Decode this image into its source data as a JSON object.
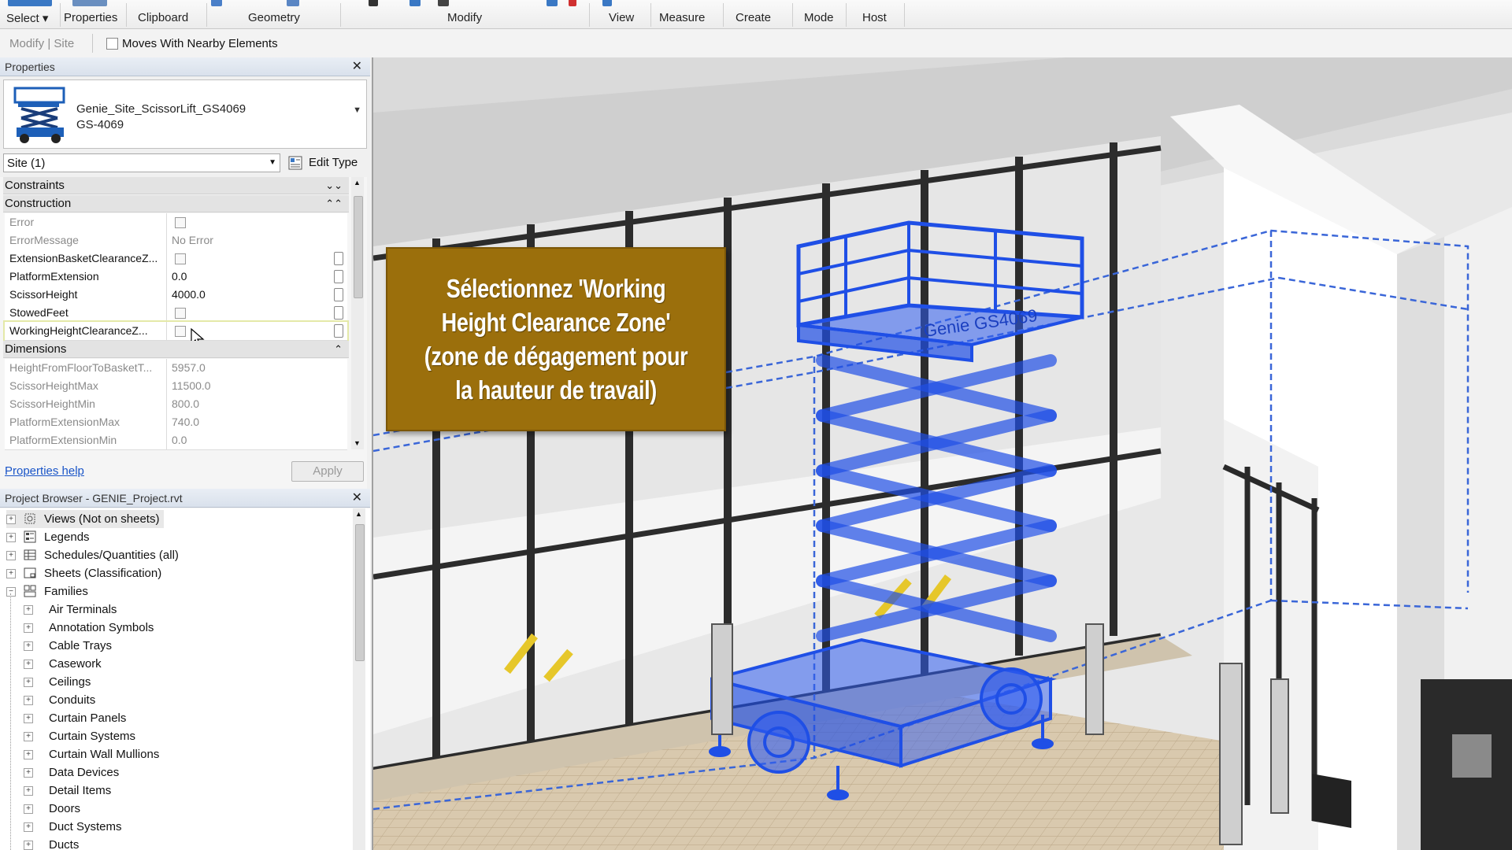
{
  "ribbon": {
    "tabs": [
      "Select",
      "Properties",
      "Clipboard",
      "Geometry",
      "Modify",
      "View",
      "Measure",
      "Create",
      "Mode",
      "Host"
    ],
    "select_caret": "▾"
  },
  "optionsbar": {
    "context": "Modify | Site",
    "moves_with_label": "Moves With Nearby Elements"
  },
  "properties": {
    "title": "Properties",
    "close": "✕",
    "family_name": "Genie_Site_ScissorLift_GS4069",
    "type_name": "GS-4069",
    "selector_value": "Site (1)",
    "edit_type_label": "Edit Type",
    "groups": {
      "constraints": "Constraints",
      "construction": "Construction",
      "dimensions": "Dimensions"
    },
    "construction_rows": [
      {
        "name": "Error",
        "value": ""
      },
      {
        "name": "ErrorMessage",
        "value": "No Error"
      },
      {
        "name": "ExtensionBasketClearanceZ...",
        "value": ""
      },
      {
        "name": "PlatformExtension",
        "value": "0.0"
      },
      {
        "name": "ScissorHeight",
        "value": "4000.0"
      },
      {
        "name": "StowedFeet",
        "value": ""
      },
      {
        "name": "WorkingHeightClearanceZ...",
        "value": ""
      }
    ],
    "dimension_rows": [
      {
        "name": "HeightFromFloorToBasketT...",
        "value": "5957.0"
      },
      {
        "name": "ScissorHeightMax",
        "value": "11500.0"
      },
      {
        "name": "ScissorHeightMin",
        "value": "800.0"
      },
      {
        "name": "PlatformExtensionMax",
        "value": "740.0"
      },
      {
        "name": "PlatformExtensionMin",
        "value": "0.0"
      }
    ],
    "help_link": "Properties help",
    "apply_label": "Apply"
  },
  "browser": {
    "title": "Project Browser - GENIE_Project.rvt",
    "close": "✕",
    "top_items": [
      "Views (Not on sheets)",
      "Legends",
      "Schedules/Quantities (all)",
      "Sheets (Classification)",
      "Families"
    ],
    "family_items": [
      "Air Terminals",
      "Annotation Symbols",
      "Cable Trays",
      "Casework",
      "Ceilings",
      "Conduits",
      "Curtain Panels",
      "Curtain Systems",
      "Curtain Wall Mullions",
      "Data Devices",
      "Detail Items",
      "Doors",
      "Duct Systems",
      "Ducts"
    ]
  },
  "callout": {
    "text": "Sélectionnez 'Working Height Clearance Zone' (zone de dégagement pour la hauteur de travail)"
  },
  "lift_label": "Genie GS4069",
  "colors": {
    "callout_bg": "#9b6f0c",
    "lift_blue": "#1f4fe6",
    "link_blue": "#1a55c8"
  }
}
